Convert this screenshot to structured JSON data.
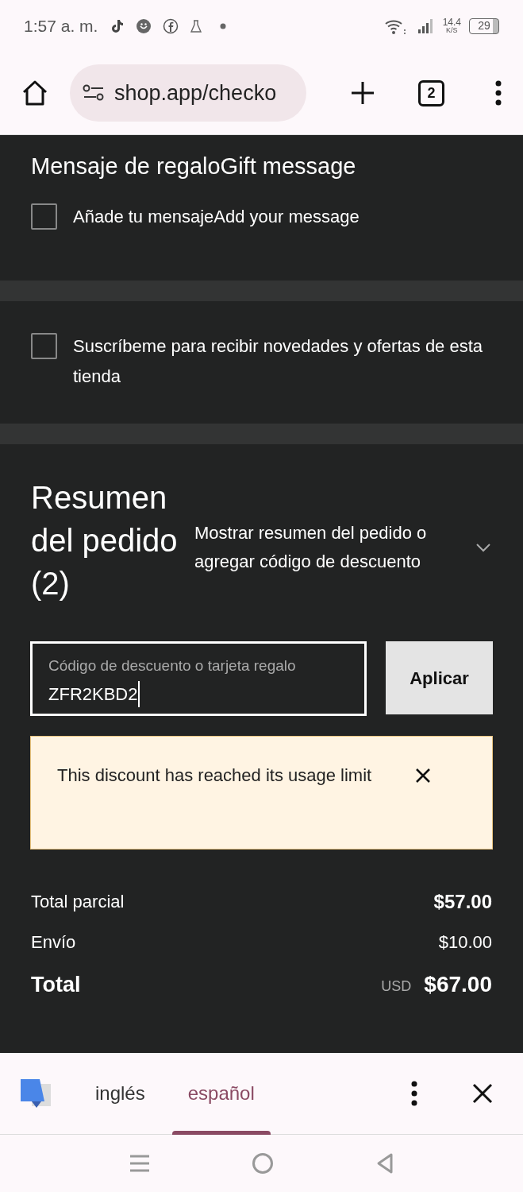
{
  "status_bar": {
    "time": "1:57 a. m.",
    "net_speed": "14.4",
    "net_unit": "K/S",
    "battery": "29"
  },
  "browser": {
    "url": "shop.app/checko",
    "tab_count": "2"
  },
  "gift_message": {
    "title": "Mensaje de regaloGift message",
    "checkbox": {
      "label": "Añade tu mensajeAdd your message",
      "checked": false
    }
  },
  "newsletter": {
    "label": "Suscríbeme para recibir novedades y ofertas de esta tienda",
    "checked": false
  },
  "order_summary": {
    "title": "Resumen del pedido (2)",
    "toggle": "Mostrar resumen del pedido o agregar código de descuento",
    "expanded": false
  },
  "discount": {
    "label": "Código de descuento o tarjeta regalo",
    "value": "ZFR2KBD2",
    "button": "Aplicar"
  },
  "alert": {
    "message": "This discount has reached its usage limit"
  },
  "totals": [
    {
      "kind": "subtotal",
      "label": "Total parcial",
      "value": "$57.00"
    },
    {
      "kind": "shipping",
      "label": "Envío",
      "value": "$10.00"
    },
    {
      "kind": "total",
      "label": "Total",
      "currency": "USD",
      "value": "$67.00"
    }
  ],
  "translate": {
    "languages": [
      {
        "label": "inglés",
        "selected": false
      },
      {
        "label": "español",
        "selected": true
      }
    ]
  }
}
